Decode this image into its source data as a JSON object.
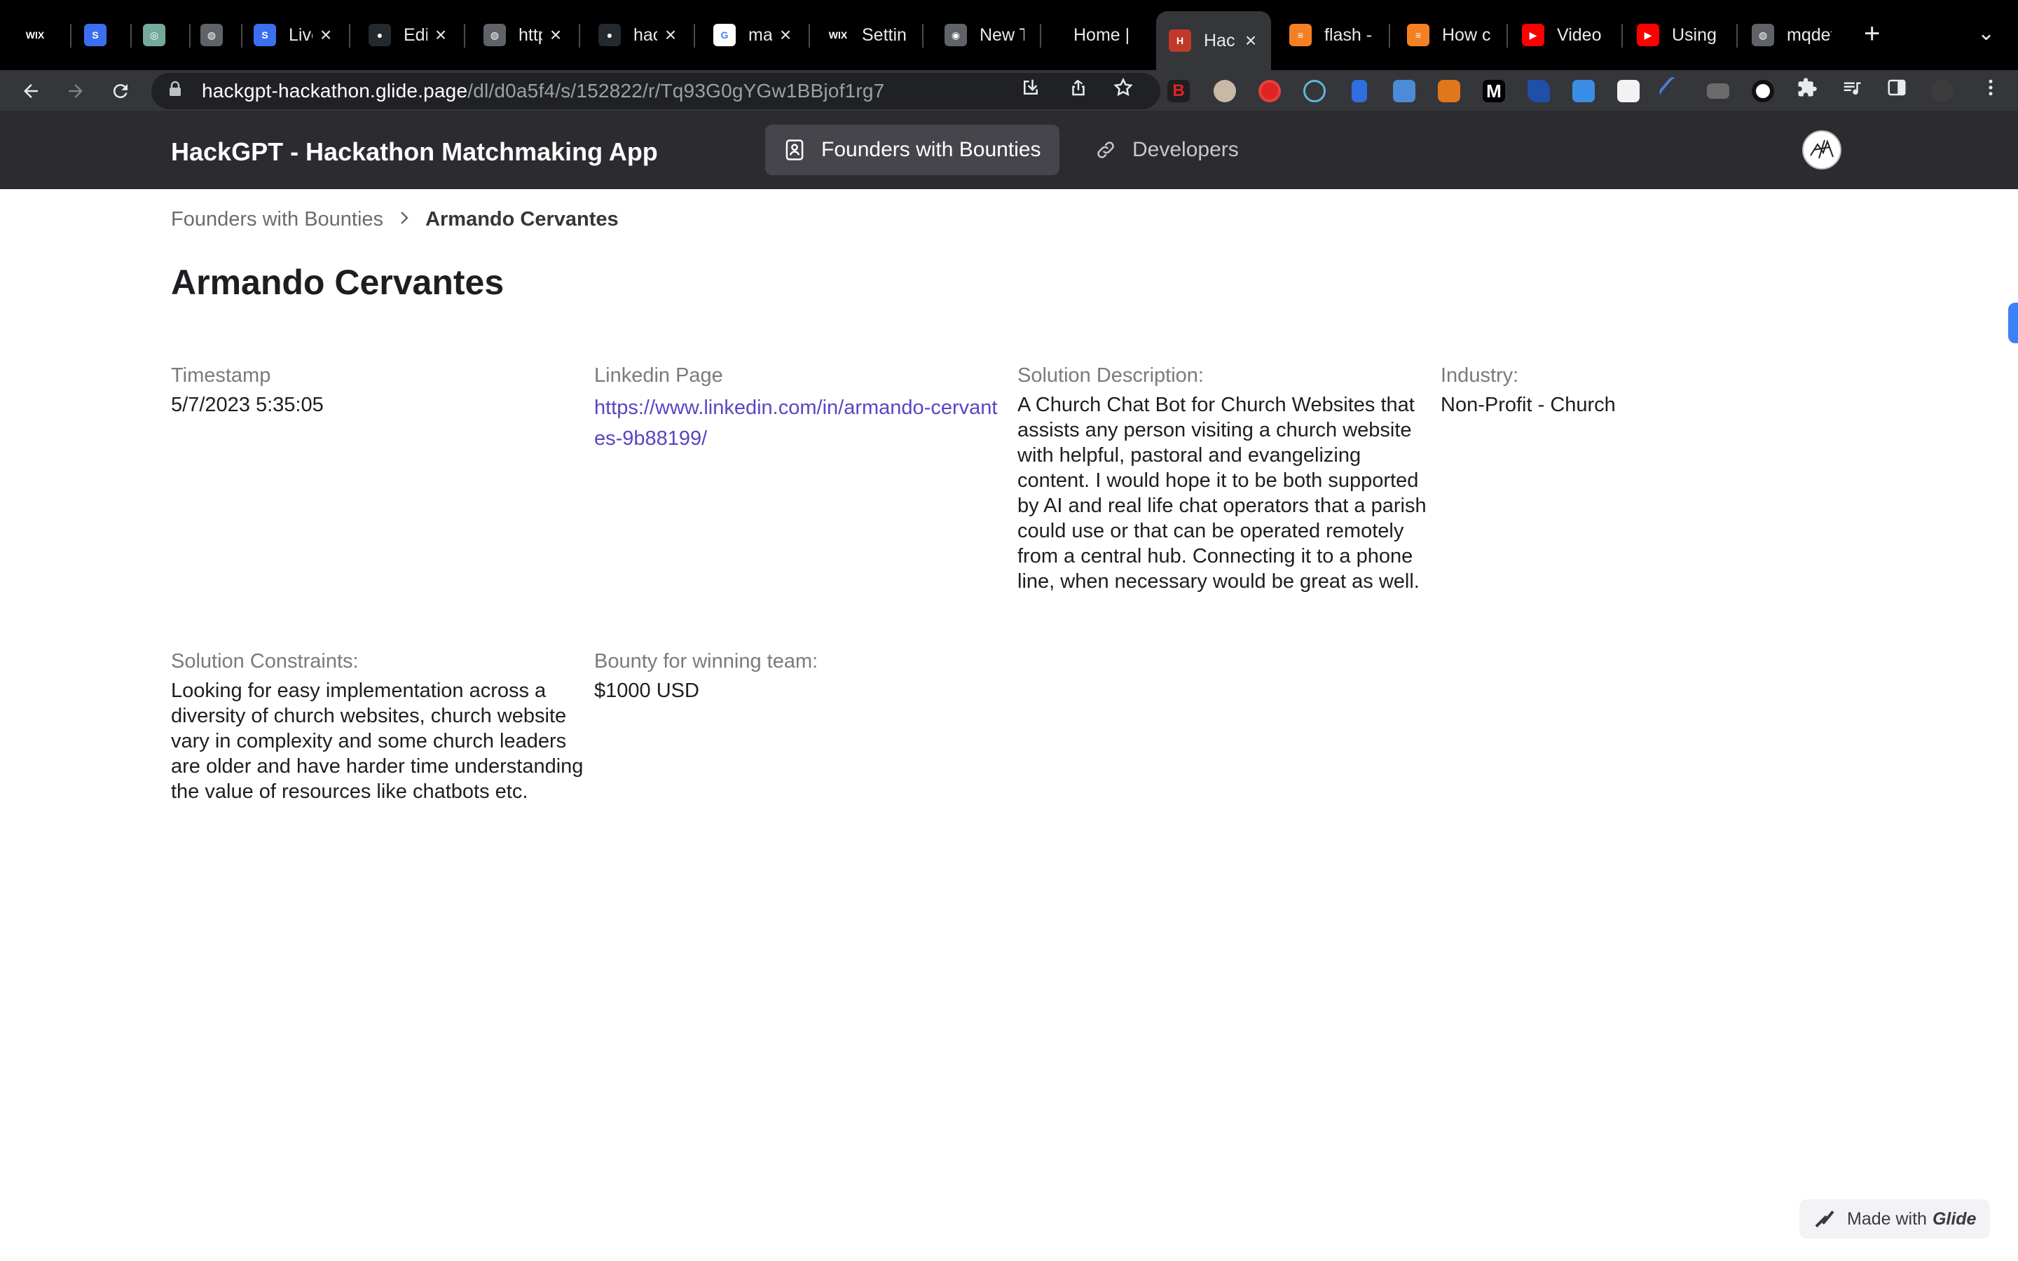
{
  "browser": {
    "tabs": [
      {
        "label": "",
        "favicon": "wix-icon",
        "fav_text": "WIX",
        "fav_color": "#000000",
        "active": false
      },
      {
        "label": "",
        "favicon": "s-blue-icon",
        "fav_text": "S",
        "fav_color": "#3b6ff0",
        "active": false
      },
      {
        "label": "",
        "favicon": "openai-icon",
        "fav_text": "◎",
        "fav_color": "#74aa9c",
        "active": false
      },
      {
        "label": "",
        "favicon": "globe-icon",
        "fav_text": "◍",
        "fav_color": "#5f6368",
        "active": false
      },
      {
        "label": "Live",
        "favicon": "s-blue-icon",
        "fav_text": "S",
        "fav_color": "#3b6ff0",
        "active": false
      },
      {
        "label": "Edit",
        "favicon": "github-icon",
        "fav_text": "●",
        "fav_color": "#24292e",
        "active": false
      },
      {
        "label": "http",
        "favicon": "globe-icon",
        "fav_text": "◍",
        "fav_color": "#5f6368",
        "active": false
      },
      {
        "label": "hac",
        "favicon": "github-icon",
        "fav_text": "●",
        "fav_color": "#24292e",
        "active": false
      },
      {
        "label": "ma",
        "favicon": "google-icon",
        "fav_text": "G",
        "fav_color": "#ffffff",
        "active": false
      },
      {
        "label": "Setting",
        "favicon": "wix-icon",
        "fav_text": "WIX",
        "fav_color": "#000000",
        "active": false
      },
      {
        "label": "New Ta",
        "favicon": "chrome-icon",
        "fav_text": "◉",
        "fav_color": "#5f6368",
        "active": false
      },
      {
        "label": "Home |",
        "favicon": "",
        "fav_text": "",
        "fav_color": "#000000",
        "active": false
      },
      {
        "label": "Hac",
        "favicon": "hackgpt-icon",
        "fav_text": "H",
        "fav_color": "#c0392b",
        "active": true
      },
      {
        "label": "flash -",
        "favicon": "stackoverflow-icon",
        "fav_text": "≡",
        "fav_color": "#f48024",
        "active": false
      },
      {
        "label": "How ca",
        "favicon": "stackoverflow-icon",
        "fav_text": "≡",
        "fav_color": "#f48024",
        "active": false
      },
      {
        "label": "Video d",
        "favicon": "youtube-icon",
        "fav_text": "▶",
        "fav_color": "#ff0000",
        "active": false
      },
      {
        "label": "Using T",
        "favicon": "youtube-icon",
        "fav_text": "▶",
        "fav_color": "#ff0000",
        "active": false
      },
      {
        "label": "mqdefa",
        "favicon": "globe-icon",
        "fav_text": "◍",
        "fav_color": "#5f6368",
        "active": false
      }
    ],
    "url_host": "hackgpt-hackathon.glide.page",
    "url_path": "/dl/d0a5f4/s/152822/r/Tq93G0gYGw1BBjof1rg7"
  },
  "app": {
    "title": "HackGPT - Hackathon Matchmaking App",
    "nav": {
      "founders_label": "Founders with Bounties",
      "developers_label": "Developers"
    }
  },
  "breadcrumb": {
    "parent": "Founders with Bounties",
    "current": "Armando Cervantes"
  },
  "page": {
    "title": "Armando Cervantes"
  },
  "fields": {
    "timestamp": {
      "label": "Timestamp",
      "value": "5/7/2023 5:35:05"
    },
    "linkedin": {
      "label": "Linkedin Page",
      "value": "https://www.linkedin.com/in/armando-cervantes-9b88199/"
    },
    "solution_description": {
      "label": "Solution Description:",
      "value": "A Church Chat Bot for Church Websites that assists any person visiting a church website with helpful, pastoral and evangelizing content. I would hope it to be both supported by AI and real life chat operators that a parish could use or that can be operated remotely from a central hub. Connecting it to a phone line, when necessary would be great as well."
    },
    "industry": {
      "label": "Industry:",
      "value": "Non-Profit - Church"
    },
    "solution_constraints": {
      "label": "Solution Constraints:",
      "value": "Looking for easy implementation across a diversity of church websites, church website vary in complexity and some church leaders are older and have harder time understanding the value of resources like chatbots etc."
    },
    "bounty": {
      "label": "Bounty for winning team:",
      "value": "$1000 USD"
    }
  },
  "footer": {
    "badge_prefix": "Made with",
    "badge_brand": "Glide"
  },
  "colors": {
    "accent_link": "#5a45c4",
    "appbar_bg": "#2b2b30",
    "side_handle": "#3b82f6"
  }
}
